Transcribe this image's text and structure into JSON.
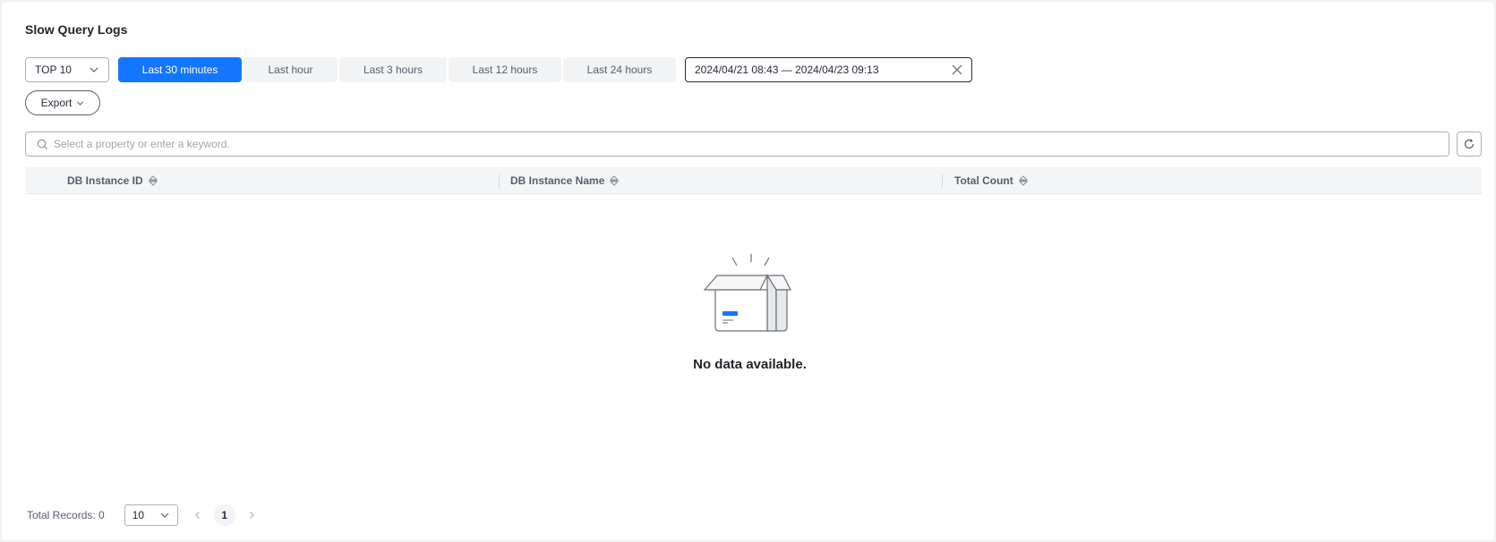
{
  "page": {
    "title": "Slow Query Logs"
  },
  "toolbar": {
    "top_select": {
      "value": "TOP 10",
      "icon": "chevron-down-icon"
    },
    "ranges": [
      {
        "label": "Last 30 minutes",
        "active": true
      },
      {
        "label": "Last hour",
        "active": false
      },
      {
        "label": "Last 3 hours",
        "active": false
      },
      {
        "label": "Last 12 hours",
        "active": false
      },
      {
        "label": "Last 24 hours",
        "active": false
      }
    ],
    "date_range": {
      "value": "2024/04/21 08:43 — 2024/04/23 09:13",
      "clear_icon": "close-icon"
    },
    "export_label": "Export"
  },
  "search": {
    "placeholder": "Select a property or enter a keyword.",
    "value": "",
    "icon": "search-icon",
    "refresh_icon": "refresh-icon"
  },
  "table": {
    "columns": [
      {
        "label": "DB Instance ID",
        "sort_icon": "sort-icon"
      },
      {
        "label": "DB Instance Name",
        "sort_icon": "sort-icon"
      },
      {
        "label": "Total Count",
        "sort_icon": "sort-icon"
      }
    ],
    "rows": [],
    "empty_text": "No data available.",
    "empty_icon": "empty-box-icon"
  },
  "footer": {
    "total_records": "Total Records: 0",
    "page_size": "10",
    "current_page": "1"
  },
  "colors": {
    "accent": "#1476ff",
    "text": "#252b3a",
    "muted": "#575d6c",
    "background": "#f0f1f5"
  }
}
